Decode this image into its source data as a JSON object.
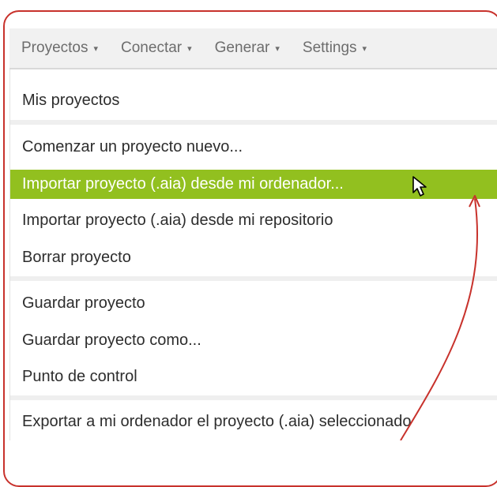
{
  "menubar": {
    "items": [
      {
        "label": "Proyectos",
        "caret": "▾"
      },
      {
        "label": "Conectar",
        "caret": "▾"
      },
      {
        "label": "Generar",
        "caret": "▾"
      },
      {
        "label": "Settings",
        "caret": "▾"
      }
    ]
  },
  "dropdown": {
    "items": [
      {
        "label": "Mis proyectos"
      },
      {
        "label": "Comenzar un proyecto nuevo..."
      },
      {
        "label": "Importar proyecto (.aia) desde mi ordenador..."
      },
      {
        "label": "Importar proyecto (.aia) desde mi repositorio"
      },
      {
        "label": "Borrar proyecto"
      },
      {
        "label": "Guardar proyecto"
      },
      {
        "label": "Guardar proyecto como..."
      },
      {
        "label": "Punto de control"
      },
      {
        "label": "Exportar a mi ordenador el proyecto (.aia) seleccionado"
      }
    ],
    "highlighted_index": 2
  },
  "icons": {
    "cursor": "mouse-pointer-icon",
    "caret": "caret-down-icon",
    "annotation": "curved-arrow-icon"
  },
  "colors": {
    "highlight": "#92c01f",
    "annotation": "#c8322c",
    "menubar_bg": "#f1f1f1",
    "divider": "#efefef"
  }
}
